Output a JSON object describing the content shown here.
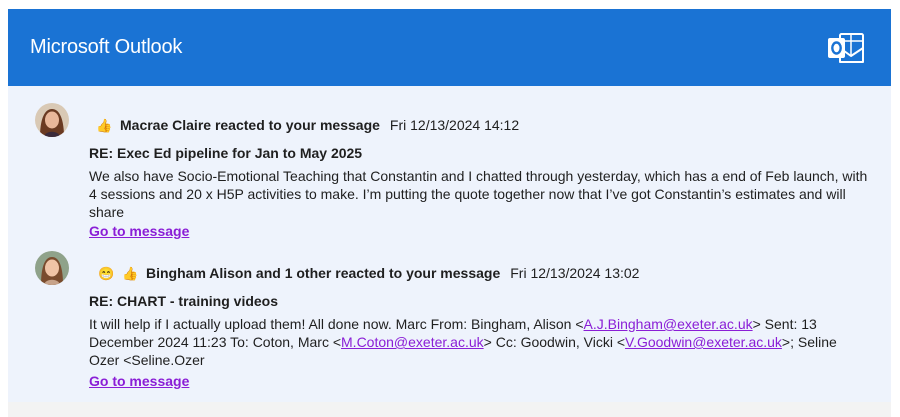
{
  "header": {
    "title": "Microsoft Outlook",
    "icon": "outlook-icon",
    "color": "#1a73d4"
  },
  "items": [
    {
      "avatar": "avatar-macrae-claire",
      "reactions": [
        "thumbs-up"
      ],
      "reactor": "Macrae Claire reacted to your message",
      "timestamp": "Fri 12/13/2024 14:12",
      "subject": "RE: Exec Ed pipeline for Jan to May 2025",
      "body": "We also have Socio-Emotional Teaching that Constantin and I chatted through yesterday, which has a end of Feb launch, with 4 sessions and 20 x H5P activities to make. I’m putting the quote together now that I’ve got Constantin’s estimates and will share",
      "link": "Go to message"
    },
    {
      "avatar": "avatar-bingham-alison",
      "reactions": [
        "laughing-face",
        "thumbs-up"
      ],
      "reactor": "Bingham Alison and 1 other reacted to your message",
      "timestamp": "Fri 12/13/2024 13:02",
      "subject": "RE: CHART - training videos",
      "body_parts": {
        "p1": "It will help if I actually upload them! All done now. Marc From: Bingham, Alison <",
        "email1": "A.J.Bingham@exeter.ac.uk",
        "p2": "> Sent: 13 December 2024 11:23 To: Coton, Marc <",
        "email2": "M.Coton@exeter.ac.uk",
        "p3": "> Cc: Goodwin, Vicki <",
        "email3": "V.Goodwin@exeter.ac.uk",
        "p4": ">; Seline Ozer <Seline.Ozer"
      },
      "link": "Go to message"
    }
  ]
}
